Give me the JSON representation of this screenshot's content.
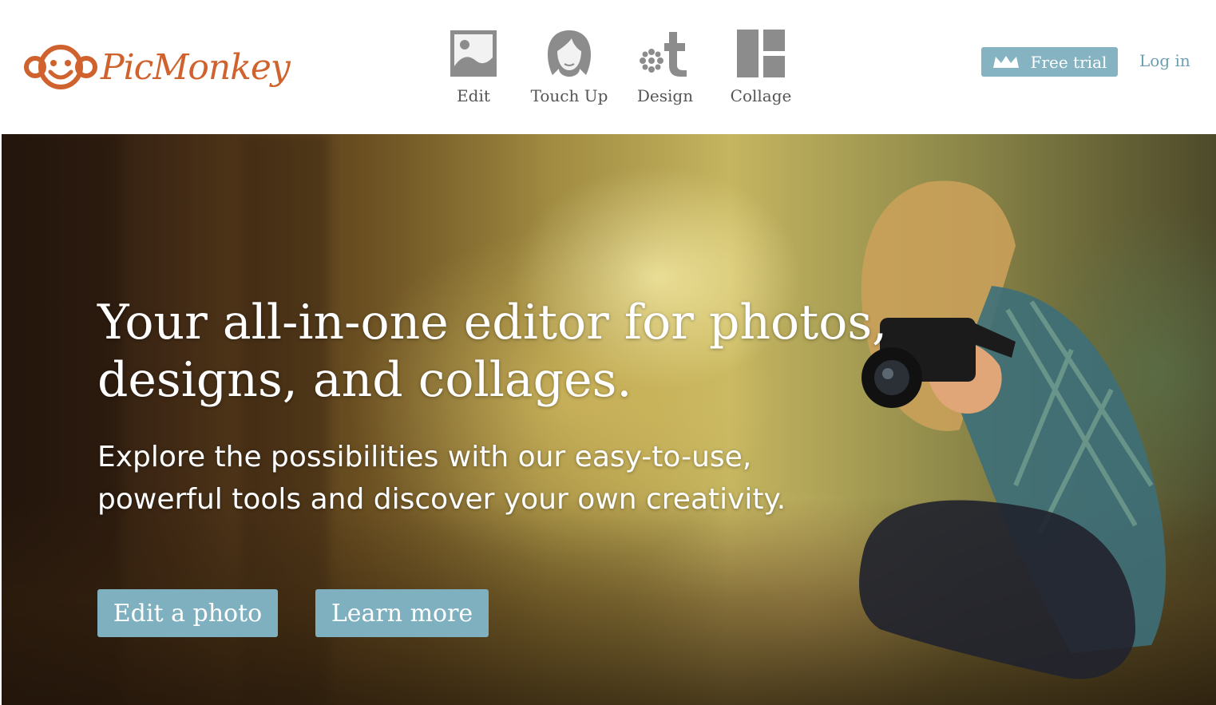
{
  "brand": {
    "name": "PicMonkey",
    "color": "#d0622e"
  },
  "nav": [
    {
      "label": "Edit",
      "icon": "image-icon"
    },
    {
      "label": "Touch Up",
      "icon": "face-icon"
    },
    {
      "label": "Design",
      "icon": "design-icon"
    },
    {
      "label": "Collage",
      "icon": "collage-icon"
    }
  ],
  "account": {
    "free_trial": "Free trial",
    "free_trial_icon": "crown-icon",
    "login": "Log in",
    "accent": "#86b3c1"
  },
  "hero": {
    "title_line1": "Your all-in-one editor for photos,",
    "title_line2": "designs, and collages.",
    "sub_line1": "Explore the possibilities with our easy-to-use,",
    "sub_line2": "powerful tools and discover your own creativity.",
    "primary_button": "Edit a photo",
    "secondary_button": "Learn more"
  }
}
